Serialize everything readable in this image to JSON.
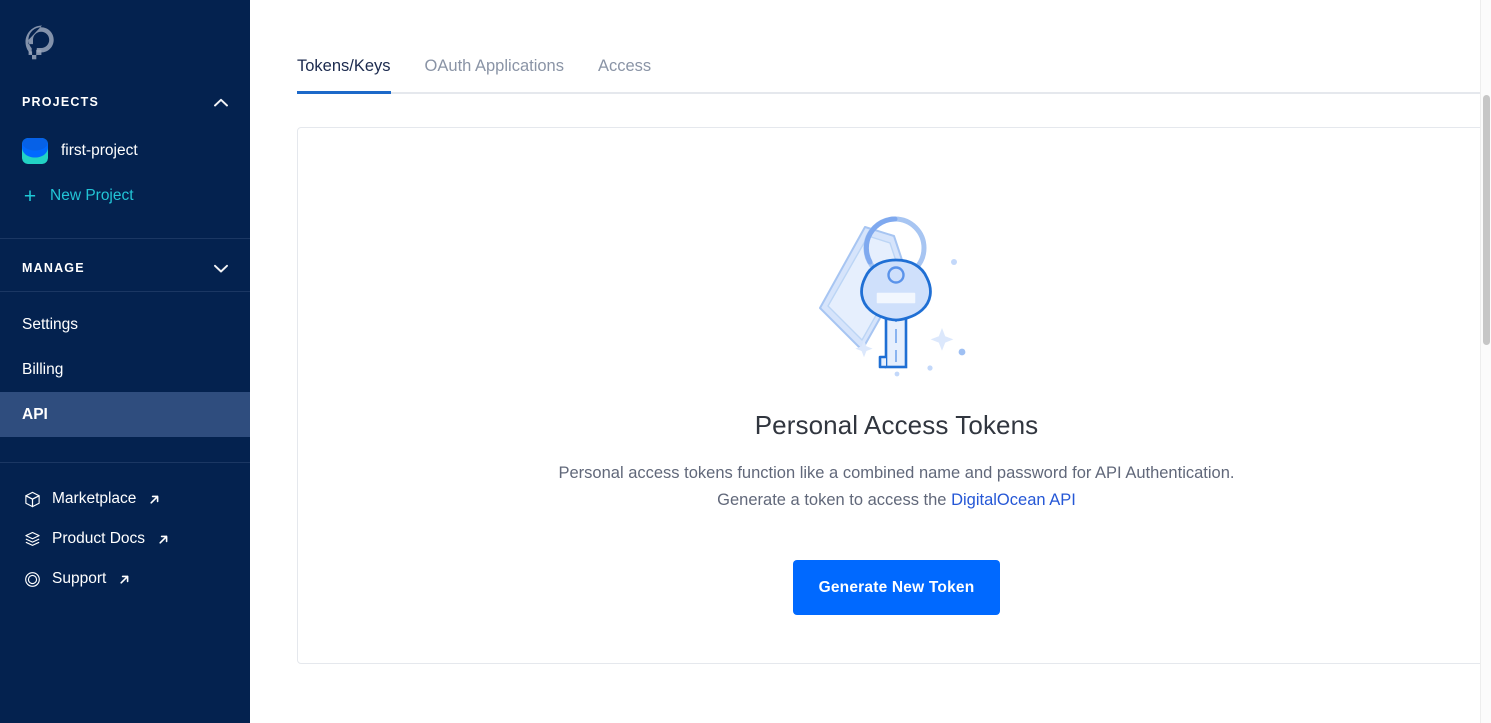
{
  "sidebar": {
    "logo": "digitalocean-logo",
    "projects": {
      "label": "PROJECTS",
      "collapse_icon": "chevron-up-icon",
      "items": [
        {
          "label": "first-project",
          "icon": "project-icon"
        }
      ],
      "new_project": {
        "label": "New Project",
        "icon": "plus-icon"
      }
    },
    "manage": {
      "label": "MANAGE",
      "collapse_icon": "chevron-down-icon",
      "items": [
        {
          "label": "Settings",
          "active": false
        },
        {
          "label": "Billing",
          "active": false
        },
        {
          "label": "API",
          "active": true
        }
      ]
    },
    "external_links": [
      {
        "label": "Marketplace",
        "icon": "cube-icon",
        "arrow": "external-link-arrow"
      },
      {
        "label": "Product Docs",
        "icon": "layers-icon",
        "arrow": "external-link-arrow"
      },
      {
        "label": "Support",
        "icon": "lifebuoy-icon",
        "arrow": "external-link-arrow"
      }
    ]
  },
  "main": {
    "tabs": [
      {
        "label": "Tokens/Keys",
        "active": true
      },
      {
        "label": "OAuth Applications",
        "active": false
      },
      {
        "label": "Access",
        "active": false
      }
    ],
    "empty_state": {
      "illustration": "key-illustration",
      "title": "Personal Access Tokens",
      "description_prefix": "Personal access tokens function like a combined name and password for API Authentication. Generate a token to access the ",
      "description_link": "DigitalOcean API",
      "button_label": "Generate New Token"
    }
  },
  "colors": {
    "sidebar_bg": "#04224f",
    "sidebar_active": "#2f4d7e",
    "accent_blue": "#0069ff",
    "tab_underline": "#1d69c9",
    "link_blue": "#2557d6",
    "teal": "#22c4d6"
  }
}
